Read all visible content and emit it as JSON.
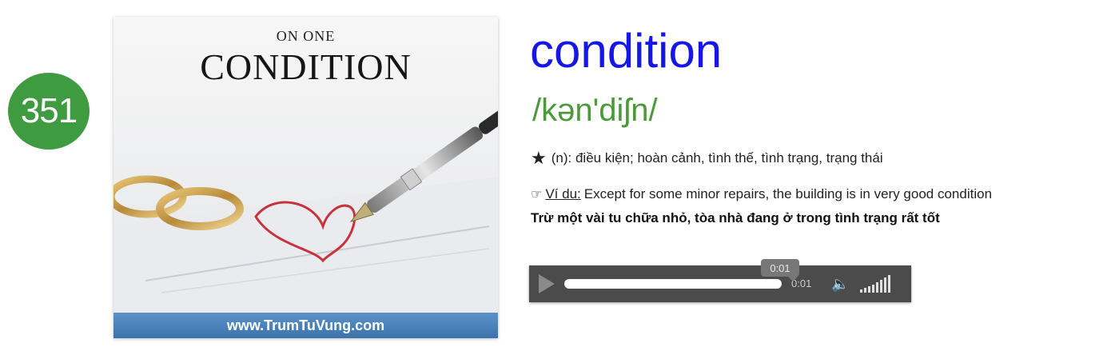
{
  "badge": {
    "number": "351"
  },
  "cover": {
    "subtitle": "ON ONE",
    "title": "CONDITION",
    "footer": "www.TrumTuVung.com"
  },
  "entry": {
    "word": "condition",
    "ipa": "/kən'diʃn/",
    "meaning": "(n): điều kiện; hoàn cảnh, tình thế, tình trạng, trạng thái",
    "example_label": "Ví du:",
    "example_text": "Except for some minor repairs, the building is in very good condition",
    "translation": "Trừ một vài tu chữa nhỏ, tòa nhà đang ở trong tình trạng rất tốt"
  },
  "audio": {
    "current_time": "0:01",
    "tooltip_time": "0:01",
    "progress": 1.0,
    "volume_level": 1.0
  },
  "colors": {
    "badge": "#3f9b3f",
    "word": "#1616e6",
    "ipa": "#4a9a3a",
    "player_bg": "#4b4b4b",
    "cover_footer": "#4a84bc"
  },
  "icons": {
    "meaning": "star-icon",
    "example": "pointing-hand-icon",
    "play": "play-icon",
    "volume": "speaker-icon"
  }
}
